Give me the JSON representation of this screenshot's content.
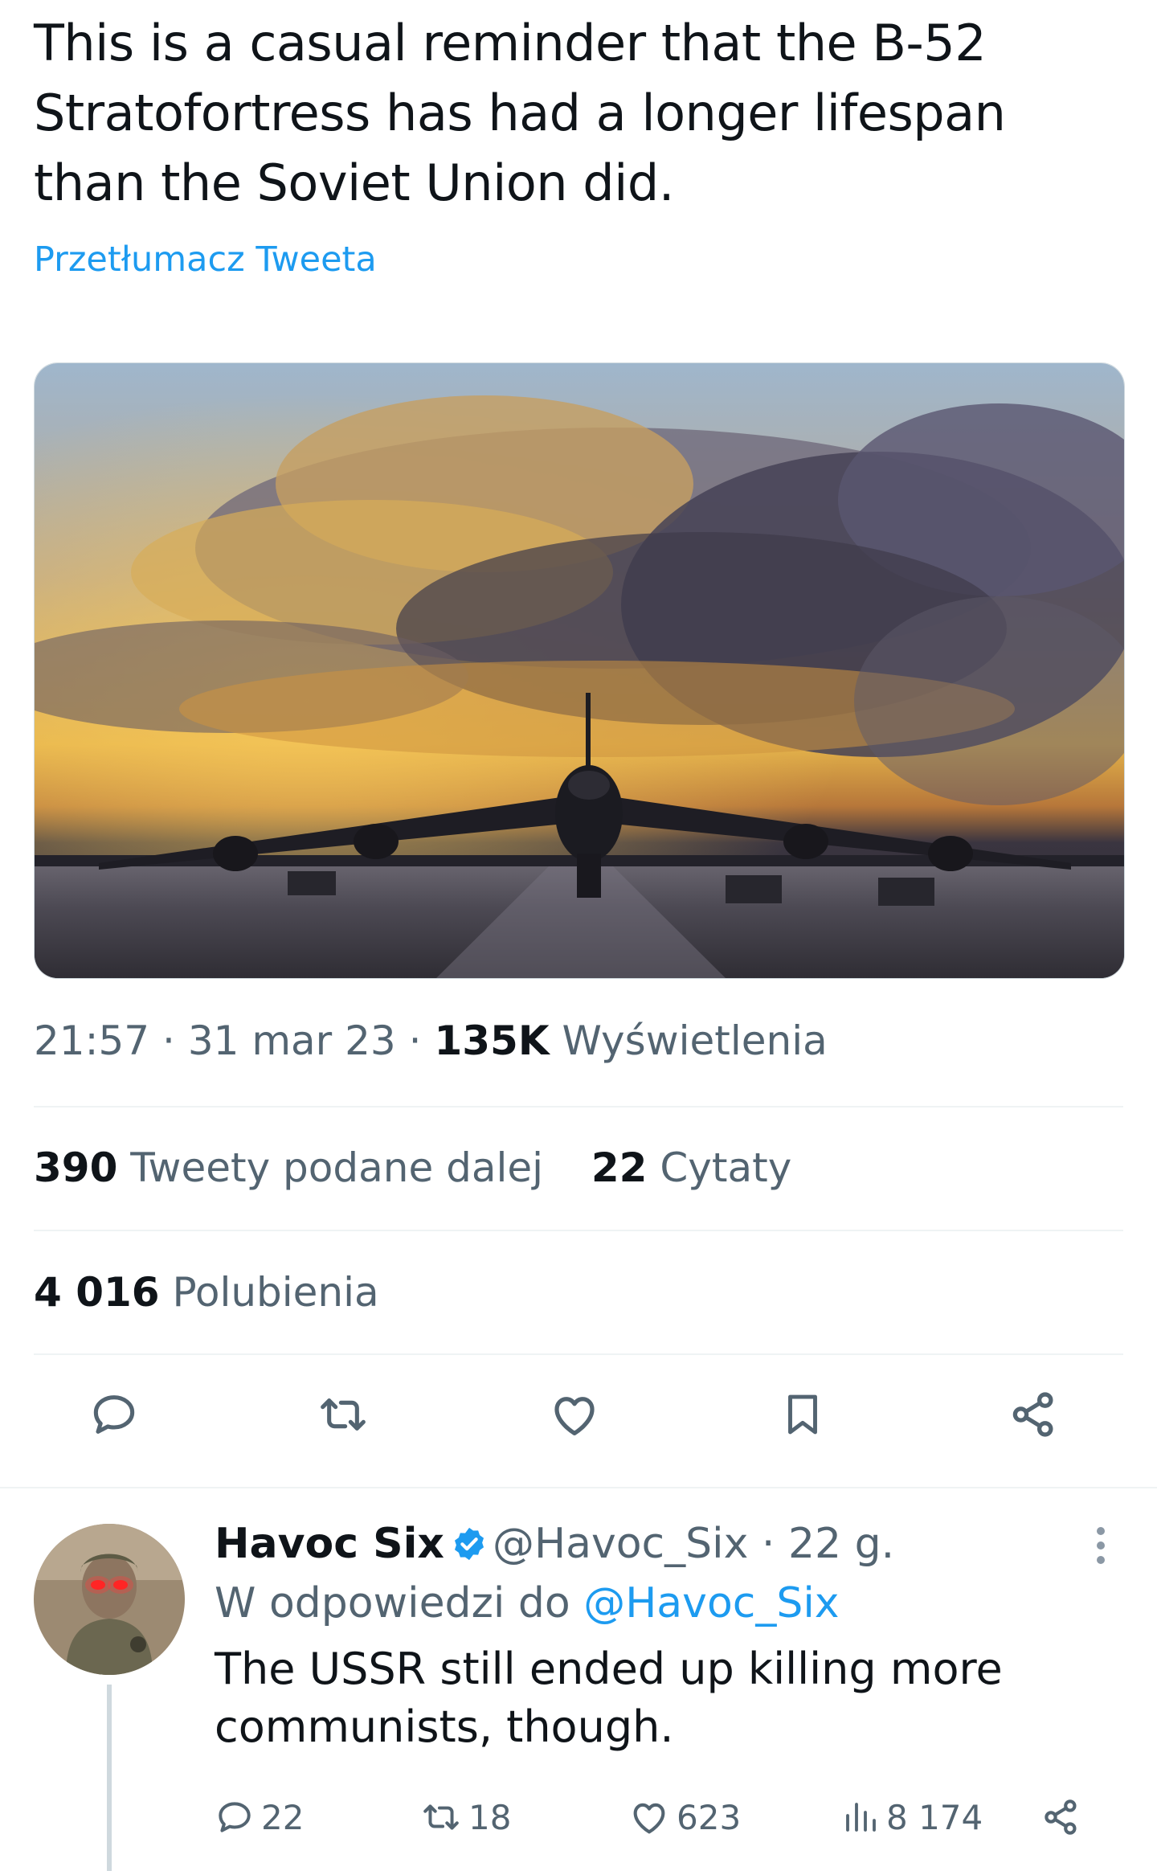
{
  "tweet": {
    "text": "This is a casual reminder that the B-52 Stratofortress has had a longer lifespan than the Soviet Union did.",
    "translate_label": "Przetłumacz Tweeta",
    "time": "21:57",
    "date": "31 mar 23",
    "separator": "·",
    "views_count": "135K",
    "views_label": "Wyświetlenia",
    "retweets_count": "390",
    "retweets_label": "Tweety podane dalej",
    "quotes_count": "22",
    "quotes_label": "Cytaty",
    "likes_count": "4 016",
    "likes_label": "Polubienia"
  },
  "actions": {
    "icons": [
      "reply-icon",
      "retweet-icon",
      "like-icon",
      "bookmark-icon",
      "share-icon"
    ]
  },
  "reply": {
    "name": "Havoc Six",
    "handle": "@Havoc_Six",
    "age": "22 g.",
    "replying_prefix": "W odpowiedzi do",
    "replying_handle": "@Havoc_Six",
    "text": "The USSR still ended up killing more communists, though.",
    "reply_count": "22",
    "retweet_count": "18",
    "like_count": "623",
    "views_count": "8 174"
  },
  "colors": {
    "accent": "#1d9bf0",
    "text_primary": "#0f1419",
    "text_secondary": "#536471",
    "divider": "#eff3f4"
  }
}
